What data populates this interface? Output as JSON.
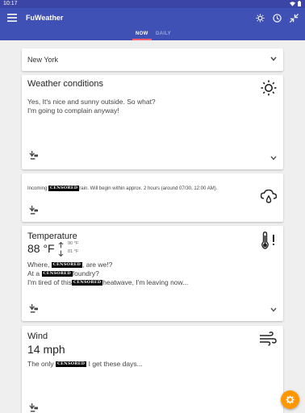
{
  "status_bar": {
    "time": "10:17"
  },
  "app_bar": {
    "title": "FuWeather"
  },
  "tabs": [
    {
      "label": "NOW"
    },
    {
      "label": "DAILY"
    }
  ],
  "location": {
    "value": "New York"
  },
  "conditions_card": {
    "title": "Weather conditions",
    "line1": "Yes, It's nice and sunny outside. So what?",
    "line2": "I'm going to complain anyway!"
  },
  "rain_card": {
    "prefix": "Incoming",
    "censored": "CENSORED",
    "suffix": "rain. Will begin within approx. 2 hours (around 07/30, 12:00 AM)."
  },
  "temperature_card": {
    "title": "Temperature",
    "value": "88 °F",
    "high": "90 °F",
    "low": "81 °F",
    "line1_a": "Where,",
    "line1_censored": "CENSORED",
    "line1_b": ", are we!?",
    "line2_a": "At a",
    "line2_censored": "CENSORED",
    "line2_b": "foundry?",
    "line3_a": "I'm tired of this",
    "line3_censored": "CENSORED",
    "line3_b": "heatwave, I'm leaving now..."
  },
  "wind_card": {
    "title": "Wind",
    "value": "14 mph",
    "line1_a": "The only",
    "line1_censored": "CENSORED",
    "line1_b": "I get these days..."
  },
  "colors": {
    "primary": "#3f51b5",
    "accent": "#ff9800",
    "tab_indicator": "#ff5a6e"
  }
}
